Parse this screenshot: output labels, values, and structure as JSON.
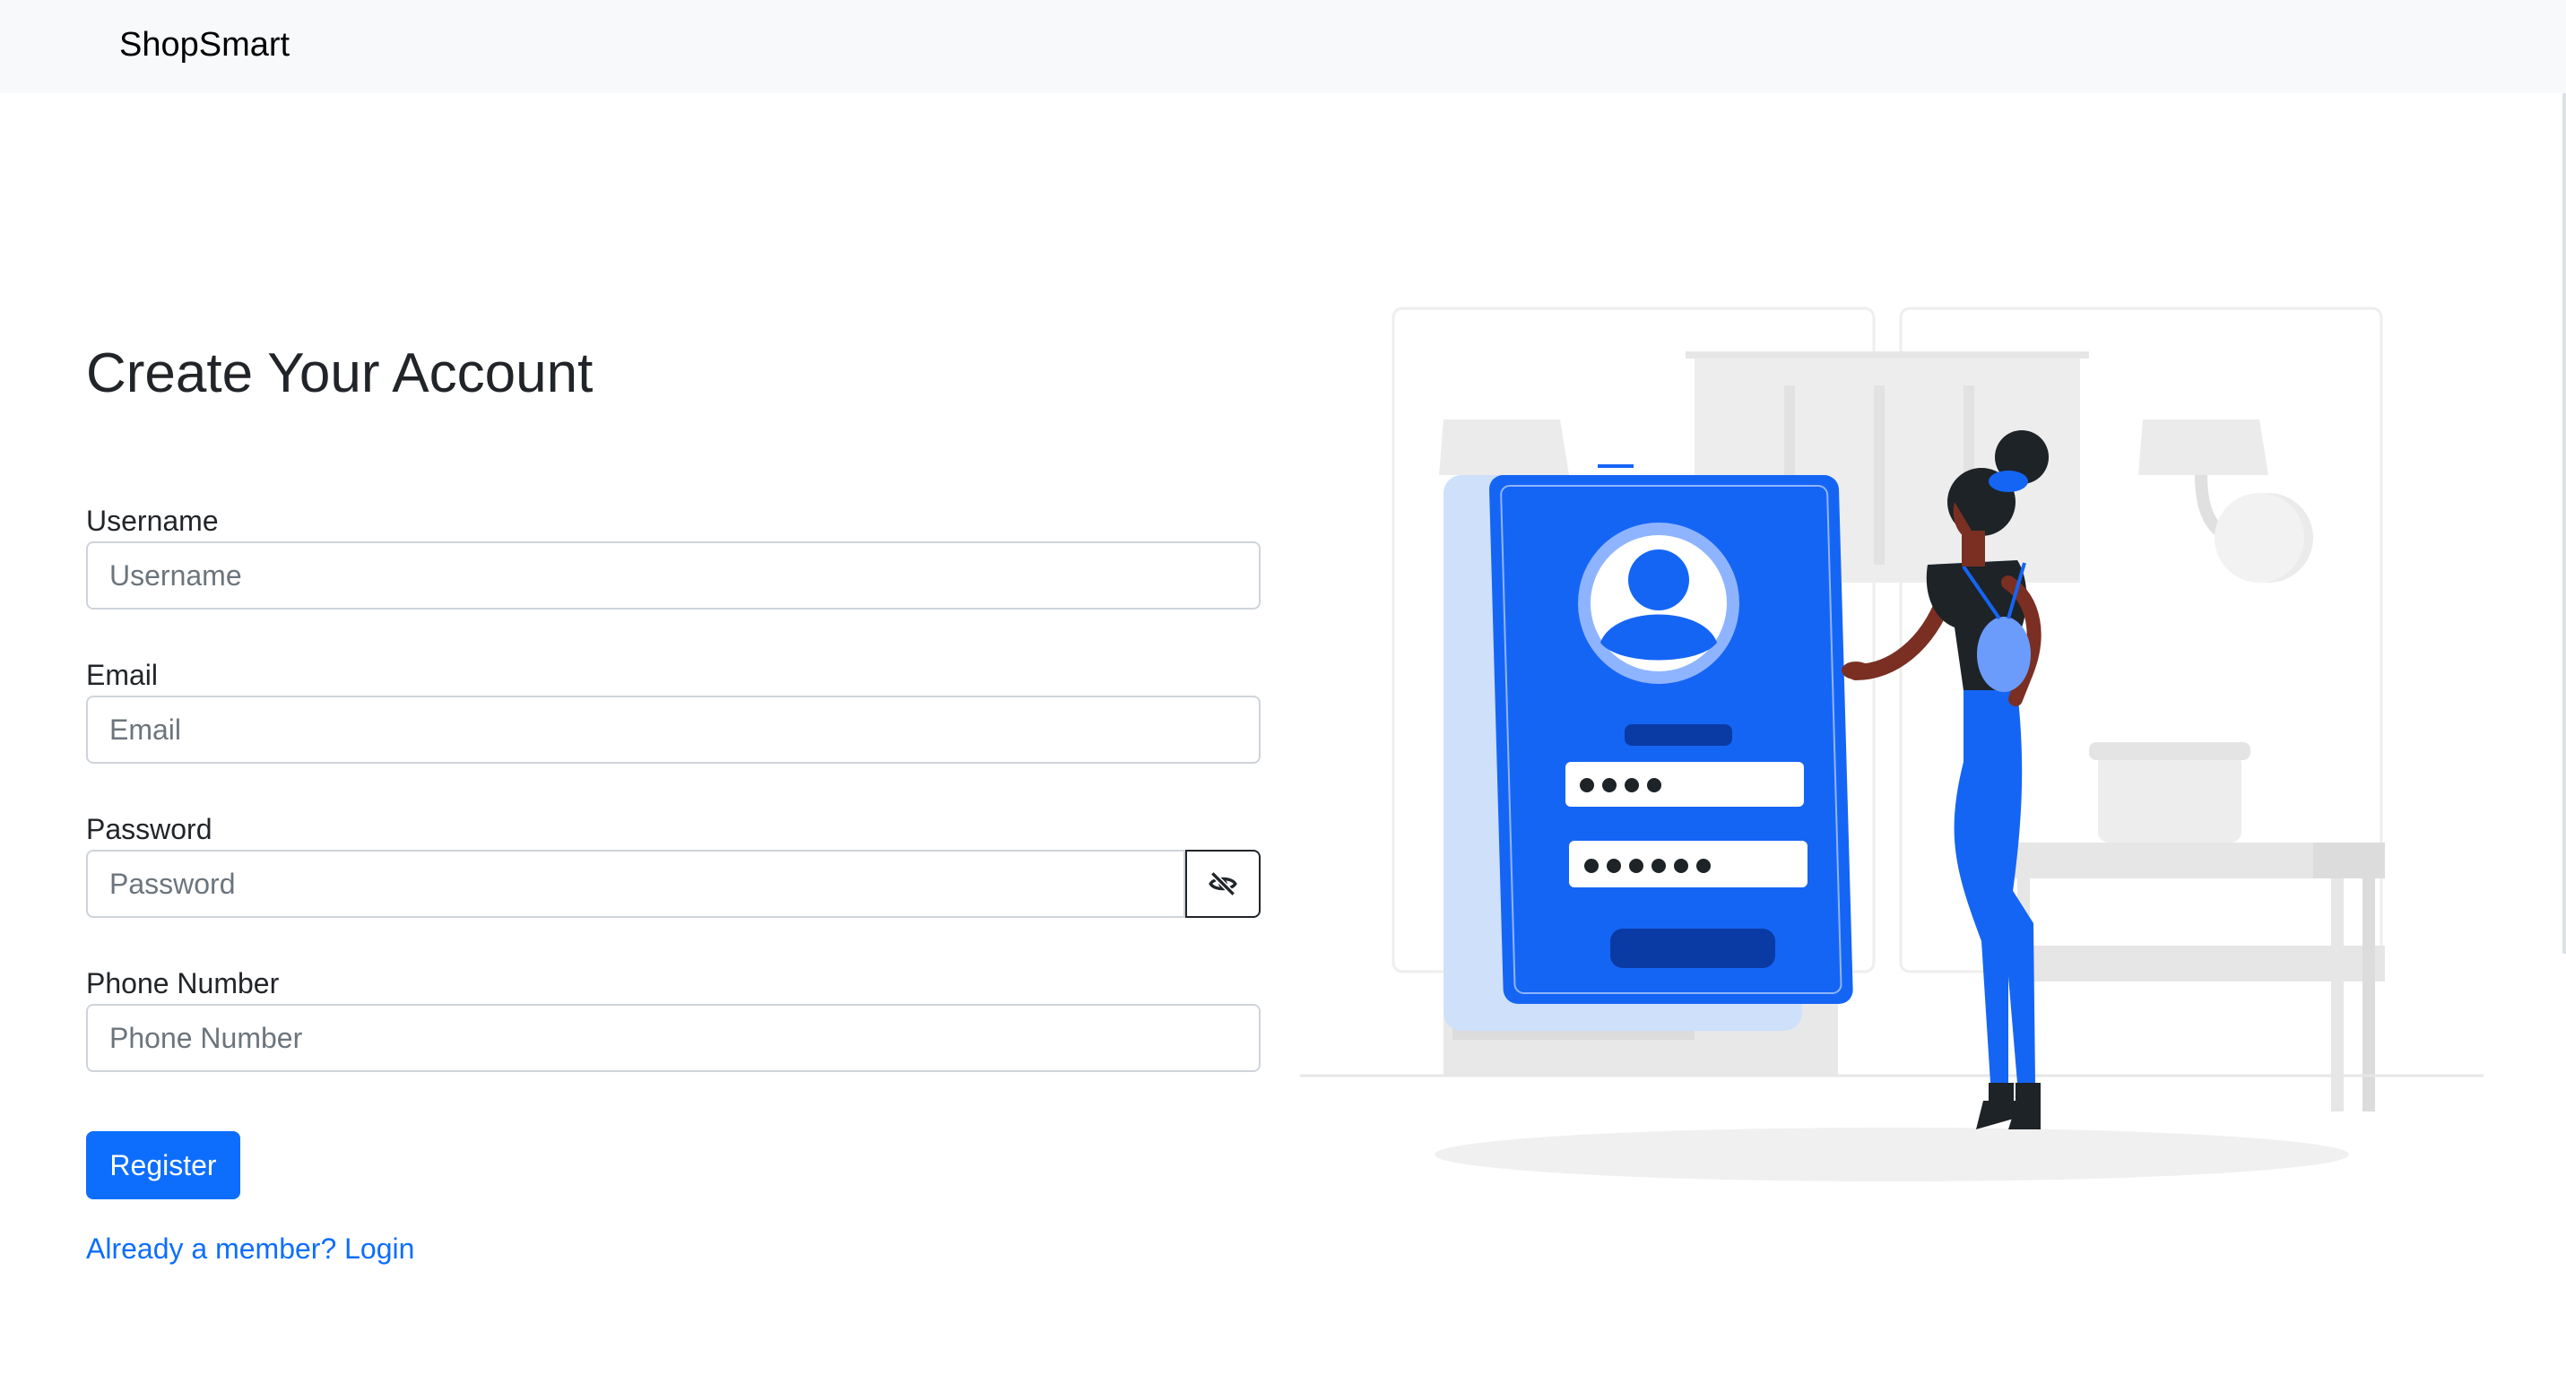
{
  "navbar": {
    "brand": "ShopSmart"
  },
  "form": {
    "title": "Create Your Account",
    "username": {
      "label": "Username",
      "placeholder": "Username",
      "value": ""
    },
    "email": {
      "label": "Email",
      "placeholder": "Email",
      "value": ""
    },
    "password": {
      "label": "Password",
      "placeholder": "Password",
      "value": "",
      "toggle_icon": "eye-slash-icon"
    },
    "phone": {
      "label": "Phone Number",
      "placeholder": "Phone Number",
      "value": ""
    },
    "register_label": "Register",
    "login_link": "Already a member? Login"
  },
  "colors": {
    "primary": "#0d6efd",
    "navbar_bg": "#f8f9fa",
    "illustration_blue": "#1565f5",
    "illustration_dark_blue": "#0a3aa3",
    "illustration_light_blue": "#cfe0fb",
    "skin": "#7a2f22",
    "hair": "#1d2327"
  },
  "illustration": {
    "icon": "registration-illustration"
  }
}
